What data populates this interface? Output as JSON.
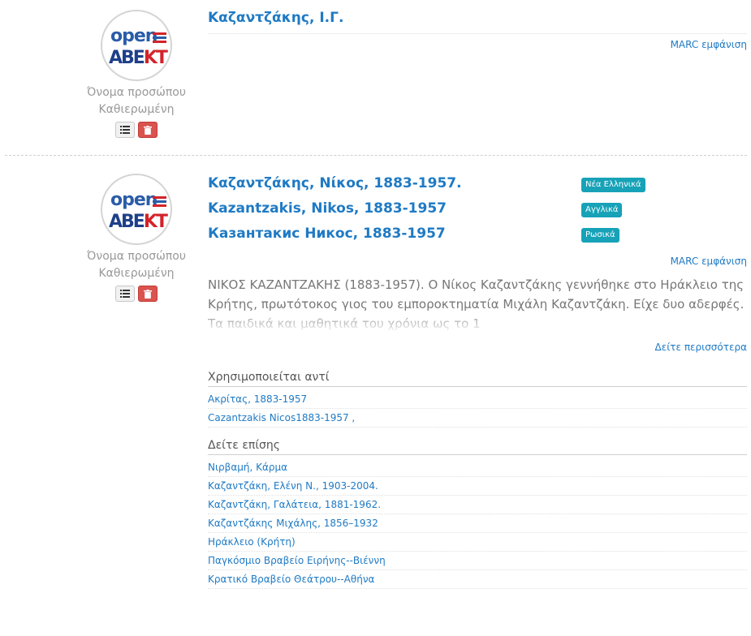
{
  "logo": {
    "text_open": "open",
    "text_abekt_blue": "ABE",
    "text_abekt_red": "KT",
    "colors": {
      "blue": "#2a5ca8",
      "red": "#d3232a"
    }
  },
  "colors": {
    "link": "#1f7ac4",
    "badge": "#17a2b8",
    "danger": "#d9534f"
  },
  "records": [
    {
      "type_label": "Όνομα προσώπου",
      "status_label": "Καθιερωμένη",
      "heading": "Καζαντζάκης, Ι.Γ.",
      "marc_link": "MARC εμφάνιση",
      "icons": [
        "list-icon",
        "trash-icon"
      ]
    },
    {
      "type_label": "Όνομα προσώπου",
      "status_label": "Καθιερωμένη",
      "headings": [
        {
          "text": "Καζαντζάκης, Νίκος, 1883-1957.",
          "lang": "Νέα Ελληνικά"
        },
        {
          "text": "Kazantzakis, Nikos, 1883-1957",
          "lang": "Αγγλικά"
        },
        {
          "text": "Казантакис Никос, 1883-1957",
          "lang": "Ρωσικά"
        }
      ],
      "marc_link": "MARC εμφάνιση",
      "bio": "ΝΙΚΟΣ ΚΑΖΑΝΤΖΑΚΗΣ (1883-1957). Ο Νίκος Καζαντζάκης γεννήθηκε στο Ηράκλειο της Κρήτης, πρωτότοκος γιος του εμποροκτηματία Μιχάλη Καζαντζάκη. Είχε δυο αδερφές. Τα παιδικά και μαθητικά του χρόνια ως το 1",
      "more_link": "Δείτε περισσότερα",
      "used_for": {
        "title": "Χρησιμοποιείται αντί",
        "items": [
          "Ακρίτας, 1883-1957",
          "Cazantzakis Nicos1883-1957 ,"
        ]
      },
      "see_also": {
        "title": "Δείτε επίσης",
        "items": [
          "Νιρβαμή, Κάρμα",
          "Καζαντζάκη, Ελένη Ν., 1903-2004.",
          "Καζαντζάκη, Γαλάτεια, 1881-1962.",
          "Καζαντζάκης Μιχάλης, 1856–1932",
          "Ηράκλειο (Κρήτη)",
          "Παγκόσμιο Βραβείο Ειρήνης--Βιέννη",
          "Κρατικό Βραβείο Θεάτρου--Αθήνα"
        ]
      }
    }
  ]
}
